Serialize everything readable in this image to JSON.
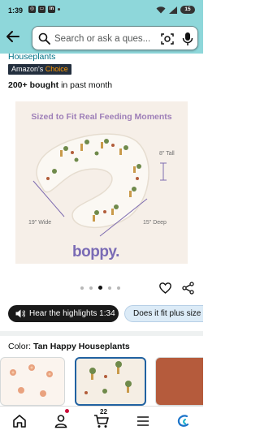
{
  "status_bar": {
    "time": "1:39",
    "battery": "15"
  },
  "search": {
    "placeholder": "Search or ask a ques..."
  },
  "product": {
    "brand_line": "Houseplants",
    "badge": "Amazon's Choice",
    "badge_main": "Amazon's",
    "badge_accent": "Choice",
    "bought_bold": "200+ bought",
    "bought_rest": "in past month",
    "image": {
      "headline": "Sized to Fit Real Feeding Moments",
      "dim_tall": "8\" Tall",
      "dim_wide": "19\" Wide",
      "dim_deep": "15\" Deep",
      "logo": "boppy."
    },
    "carousel": {
      "count": 5,
      "active_index": 2
    }
  },
  "actions": {
    "highlights_label": "Hear the highlights 1:34",
    "fit_label": "Does it fit plus size"
  },
  "color": {
    "label": "Color:",
    "value": "Tan Happy Houseplants"
  },
  "cart": {
    "count": "22"
  },
  "colors": {
    "header_bg": "#8ed7da",
    "link": "#007185",
    "selected_border": "#2162a1"
  }
}
